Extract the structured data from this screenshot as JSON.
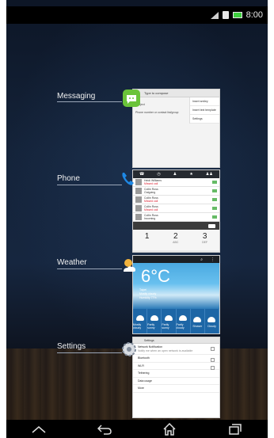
{
  "status_bar": {
    "time": "8:00",
    "icons": [
      "signal-icon",
      "sim-icon",
      "battery-icon"
    ]
  },
  "recent_apps": [
    {
      "label": "Messaging",
      "icon": "messaging-icon",
      "icon_color": "#6ac33a",
      "preview": {
        "header": "Type to compose",
        "menu": [
          "Insert smiley",
          "Insert text template",
          "Settings"
        ],
        "rows": [
          "Subject",
          "Phone number or contact list/group"
        ]
      }
    },
    {
      "label": "Phone",
      "icon": "phone-icon",
      "icon_color": "#1e88e5",
      "preview": {
        "tabs": [
          "phone",
          "history",
          "contacts",
          "favorites",
          "groups"
        ],
        "calls": [
          {
            "name": "Heidi Williams",
            "detail": "Missed call"
          },
          {
            "name": "Collin Ross",
            "detail": "Outgoing"
          },
          {
            "name": "Collin Ross",
            "detail": "Missed call"
          },
          {
            "name": "Collin Ross",
            "detail": "Missed call"
          },
          {
            "name": "Collin Ross",
            "detail": "Incoming"
          }
        ],
        "keys": [
          {
            "digit": "1",
            "letters": ""
          },
          {
            "digit": "2",
            "letters": "ABC"
          },
          {
            "digit": "3",
            "letters": "DEF"
          }
        ]
      }
    },
    {
      "label": "Weather",
      "icon": "weather-icon",
      "icon_color": "#f2b33d",
      "preview": {
        "temperature": "6°C",
        "info": [
          "Taipei",
          "Mostly cloudy",
          "Humidity 77%"
        ],
        "forecast": [
          "Mostly cloudy",
          "Partly sunny",
          "Partly sunny",
          "Partly cloudy",
          "Shower",
          "Cloudy"
        ]
      }
    },
    {
      "label": "Settings",
      "icon": "settings-icon",
      "icon_color": "#7f8a99",
      "preview": {
        "header": "Settings",
        "rows": [
          {
            "title": "Network Notification",
            "sub": "Notify me when an open network is available"
          },
          {
            "title": "Bluetooth"
          },
          {
            "title": "Wi-Fi"
          },
          {
            "title": "Tethering"
          },
          {
            "title": "Data usage"
          },
          {
            "title": "More"
          }
        ]
      }
    }
  ],
  "nav_bar": [
    "up-icon",
    "back-icon",
    "home-icon",
    "recent-apps-icon"
  ]
}
